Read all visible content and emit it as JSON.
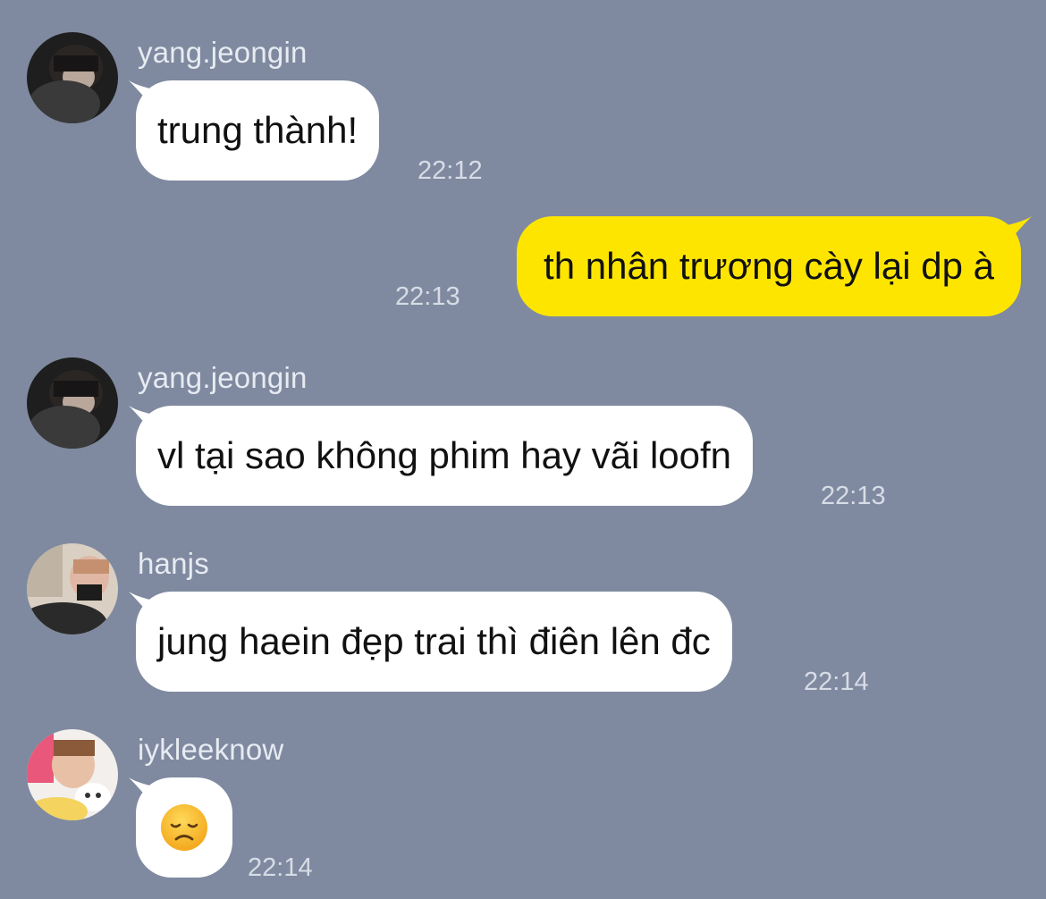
{
  "messages": [
    {
      "sender": "yang.jeongin",
      "text": "trung thành!",
      "time": "22:12",
      "direction": "incoming",
      "avatar": "avatar-yang-jeongin"
    },
    {
      "text": "th nhân trương cày lại dp à",
      "time": "22:13",
      "direction": "outgoing"
    },
    {
      "sender": "yang.jeongin",
      "text": "vl tại sao không phim hay vãi loofn",
      "time": "22:13",
      "direction": "incoming",
      "avatar": "avatar-yang-jeongin"
    },
    {
      "sender": "hanjs",
      "text": "jung haein đẹp trai thì điên lên đc",
      "time": "22:14",
      "direction": "incoming",
      "avatar": "avatar-hanjs"
    },
    {
      "sender": "iykleeknow",
      "text": "",
      "emoji": "disappointed-face-emoji",
      "time": "22:14",
      "direction": "incoming",
      "avatar": "avatar-iykleeknow"
    }
  ],
  "colors": {
    "background": "#7f8aa0",
    "incoming_bubble": "#ffffff",
    "outgoing_bubble": "#fee500",
    "timestamp": "#d7dce6",
    "sender_name": "#e7ebf2"
  }
}
